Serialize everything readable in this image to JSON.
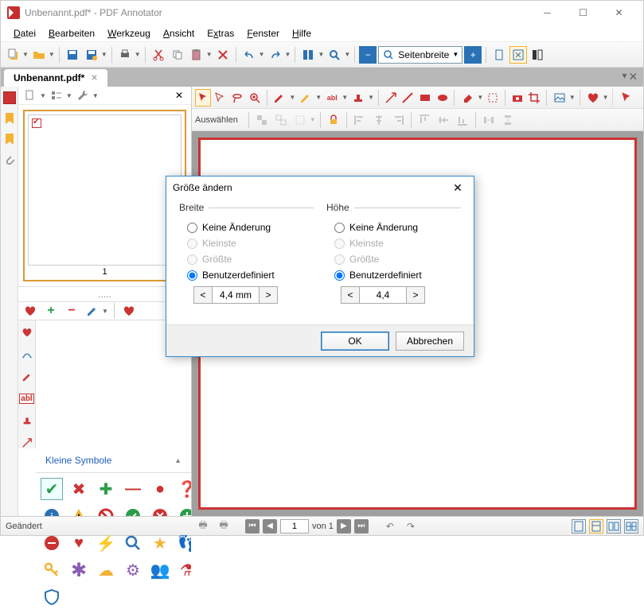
{
  "titlebar": {
    "text": "Unbenannt.pdf* - PDF Annotator"
  },
  "menu": {
    "items": [
      "Datei",
      "Bearbeiten",
      "Werkzeug",
      "Ansicht",
      "Extras",
      "Fenster",
      "Hilfe"
    ]
  },
  "toolbar": {
    "zoom_label": "Seitenbreite"
  },
  "tab": {
    "name": "Unbenannt.pdf*"
  },
  "sidepanel": {
    "thumb_number": "1",
    "dots": ".....",
    "panel_label": "Kleine Symbole"
  },
  "tooltabs": {
    "select_label": "Auswählen"
  },
  "dialog": {
    "title": "Größe ändern",
    "width_legend": "Breite",
    "height_legend": "Höhe",
    "opt_nochange": "Keine Änderung",
    "opt_smallest": "Kleinste",
    "opt_largest": "Größte",
    "opt_custom": "Benutzerdefiniert",
    "width_val": "4,4 mm",
    "height_val": "4,4",
    "ok": "OK",
    "cancel": "Abbrechen"
  },
  "statusbar": {
    "changed": "Geändert",
    "page": "1",
    "of": "von 1"
  }
}
